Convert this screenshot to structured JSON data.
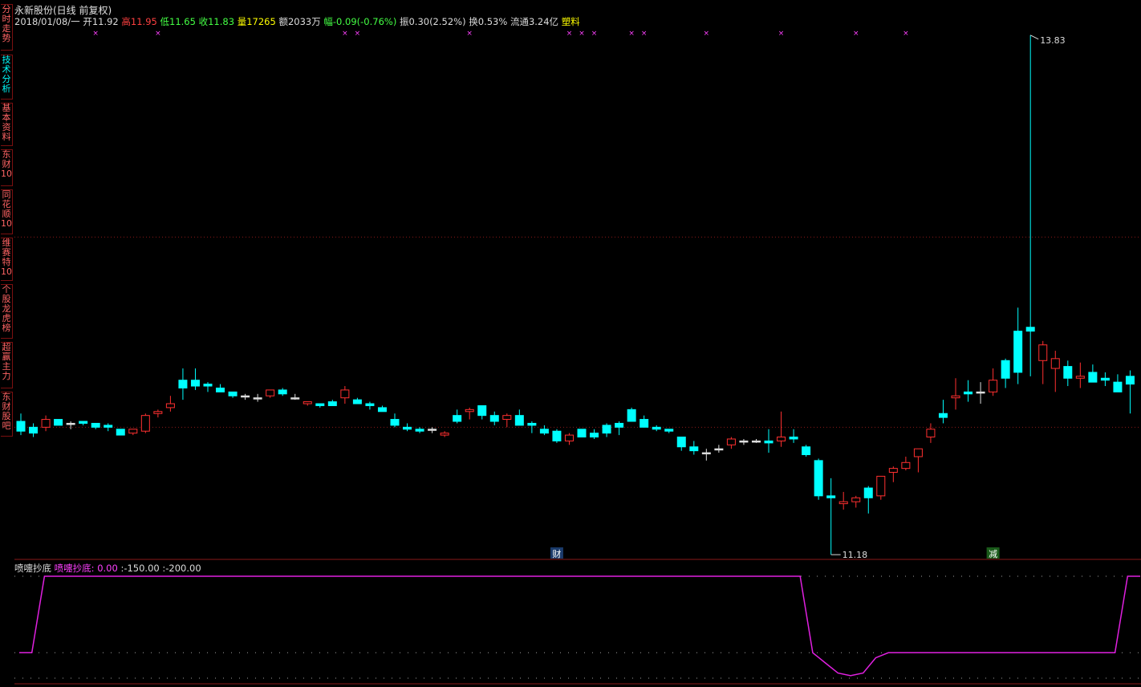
{
  "sidebar": {
    "tabs": [
      {
        "label": "分时走势",
        "active": false
      },
      {
        "label": "技术分析",
        "active": true
      },
      {
        "label": "基本资料",
        "active": false
      },
      {
        "label": "东财10",
        "active": false
      },
      {
        "label": "同花顺10",
        "active": false
      },
      {
        "label": "维赛特10",
        "active": false
      },
      {
        "label": "个股龙虎榜",
        "active": false
      },
      {
        "label": "超赢主力",
        "active": false
      },
      {
        "label": "东财股吧",
        "active": false
      }
    ]
  },
  "header": {
    "title": "永新股份(日线 前复权)",
    "date": "2018/01/08/一",
    "open_label": "开",
    "open": "11.92",
    "high_label": "高",
    "high": "11.95",
    "low_label": "低",
    "low": "11.65",
    "close_label": "收",
    "close": "11.83",
    "volume_label": "量",
    "volume": "17265",
    "amount_label": "额",
    "amount": "2033万",
    "change_label": "幅",
    "change": "-0.09(-0.76%)",
    "amplitude_label": "振",
    "amplitude": "0.30(2.52%)",
    "turnover_label": "换",
    "turnover": "0.53%",
    "float_label": "流通",
    "float_cap": "3.24亿",
    "sector": "塑料"
  },
  "indicator": {
    "name": "喷嚏抄底",
    "series_label": "喷嚏抄底:",
    "value": "0.00",
    "level1": ":-150.00",
    "level2": ":-200.00"
  },
  "chart_data": {
    "type": "candlestick",
    "max_label": "13.83",
    "min_label": "11.18",
    "event_markers": [
      {
        "label": "财",
        "index": 43
      },
      {
        "label": "减",
        "index": 78
      }
    ],
    "colors": {
      "up": "#ff3030",
      "down": "#00ffff",
      "indicator": "#e020e0",
      "grid": "#8a1a1a",
      "dots": "#a0a0a0"
    },
    "candles": [
      [
        11.86,
        11.9,
        11.79,
        11.81
      ],
      [
        11.83,
        11.85,
        11.78,
        11.8
      ],
      [
        11.83,
        11.89,
        11.81,
        11.87
      ],
      [
        11.87,
        11.87,
        11.84,
        11.84
      ],
      [
        11.85,
        11.86,
        11.82,
        11.85
      ],
      [
        11.86,
        11.86,
        11.84,
        11.85
      ],
      [
        11.85,
        11.85,
        11.82,
        11.83
      ],
      [
        11.84,
        11.85,
        11.81,
        11.83
      ],
      [
        11.82,
        11.82,
        11.79,
        11.79
      ],
      [
        11.8,
        11.82,
        11.79,
        11.82
      ],
      [
        11.81,
        11.9,
        11.8,
        11.89
      ],
      [
        11.9,
        11.92,
        11.88,
        11.91
      ],
      [
        11.93,
        11.99,
        11.91,
        11.95
      ],
      [
        12.07,
        12.13,
        11.97,
        12.03
      ],
      [
        12.07,
        12.13,
        12.02,
        12.04
      ],
      [
        12.05,
        12.06,
        12.01,
        12.04
      ],
      [
        12.03,
        12.05,
        12.01,
        12.01
      ],
      [
        12.01,
        12.01,
        11.98,
        11.99
      ],
      [
        11.99,
        12.0,
        11.97,
        11.99
      ],
      [
        11.98,
        12.0,
        11.96,
        11.98
      ],
      [
        11.99,
        12.02,
        11.98,
        12.02
      ],
      [
        12.02,
        12.03,
        11.99,
        12.0
      ],
      [
        11.98,
        12.0,
        11.97,
        11.98
      ],
      [
        11.95,
        11.96,
        11.94,
        11.96
      ],
      [
        11.95,
        11.95,
        11.93,
        11.94
      ],
      [
        11.96,
        11.97,
        11.94,
        11.94
      ],
      [
        11.98,
        12.04,
        11.95,
        12.02
      ],
      [
        11.97,
        11.98,
        11.95,
        11.95
      ],
      [
        11.95,
        11.96,
        11.92,
        11.94
      ],
      [
        11.93,
        11.94,
        11.91,
        11.91
      ],
      [
        11.87,
        11.9,
        11.83,
        11.84
      ],
      [
        11.83,
        11.85,
        11.81,
        11.82
      ],
      [
        11.82,
        11.83,
        11.8,
        11.81
      ],
      [
        11.82,
        11.83,
        11.8,
        11.82
      ],
      [
        11.79,
        11.81,
        11.78,
        11.8
      ],
      [
        11.89,
        11.92,
        11.85,
        11.86
      ],
      [
        11.91,
        11.93,
        11.87,
        11.92
      ],
      [
        11.94,
        11.94,
        11.87,
        11.89
      ],
      [
        11.89,
        11.91,
        11.84,
        11.86
      ],
      [
        11.87,
        11.9,
        11.83,
        11.89
      ],
      [
        11.89,
        11.92,
        11.84,
        11.84
      ],
      [
        11.85,
        11.86,
        11.8,
        11.84
      ],
      [
        11.82,
        11.84,
        11.79,
        11.8
      ],
      [
        11.81,
        11.82,
        11.75,
        11.76
      ],
      [
        11.76,
        11.8,
        11.74,
        11.79
      ],
      [
        11.82,
        11.82,
        11.79,
        11.78
      ],
      [
        11.8,
        11.82,
        11.77,
        11.78
      ],
      [
        11.84,
        11.85,
        11.78,
        11.8
      ],
      [
        11.85,
        11.86,
        11.79,
        11.83
      ],
      [
        11.92,
        11.93,
        11.9,
        11.86
      ],
      [
        11.87,
        11.89,
        11.84,
        11.83
      ],
      [
        11.83,
        11.84,
        11.81,
        11.82
      ],
      [
        11.82,
        11.82,
        11.8,
        11.81
      ],
      [
        11.78,
        11.78,
        11.71,
        11.73
      ],
      [
        11.73,
        11.76,
        11.69,
        11.71
      ],
      [
        11.7,
        11.72,
        11.66,
        11.7
      ],
      [
        11.72,
        11.74,
        11.7,
        11.72
      ],
      [
        11.74,
        11.78,
        11.72,
        11.77
      ],
      [
        11.76,
        11.77,
        11.74,
        11.76
      ],
      [
        11.76,
        11.77,
        11.75,
        11.76
      ],
      [
        11.76,
        11.82,
        11.7,
        11.75
      ],
      [
        11.76,
        11.91,
        11.73,
        11.78
      ],
      [
        11.78,
        11.82,
        11.75,
        11.77
      ],
      [
        11.73,
        11.74,
        11.68,
        11.69
      ],
      [
        11.66,
        11.67,
        11.46,
        11.48
      ],
      [
        11.48,
        11.57,
        11.18,
        11.47
      ],
      [
        11.44,
        11.5,
        11.41,
        11.45
      ],
      [
        11.45,
        11.48,
        11.42,
        11.47
      ],
      [
        11.52,
        11.53,
        11.39,
        11.47
      ],
      [
        11.48,
        11.58,
        11.46,
        11.58
      ],
      [
        11.6,
        11.63,
        11.55,
        11.62
      ],
      [
        11.62,
        11.68,
        11.61,
        11.65
      ],
      [
        11.68,
        11.72,
        11.6,
        11.72
      ],
      [
        11.78,
        11.85,
        11.75,
        11.82
      ],
      [
        11.9,
        11.97,
        11.85,
        11.88
      ],
      [
        11.98,
        12.08,
        11.92,
        11.99
      ],
      [
        12.01,
        12.07,
        11.96,
        12.0
      ],
      [
        12.01,
        12.06,
        11.95,
        12.01
      ],
      [
        12.01,
        12.13,
        11.99,
        12.07
      ],
      [
        12.17,
        12.18,
        12.03,
        12.08
      ],
      [
        12.32,
        12.44,
        12.05,
        12.11
      ],
      [
        12.34,
        13.83,
        12.09,
        12.32
      ],
      [
        12.17,
        12.27,
        12.05,
        12.25
      ],
      [
        12.13,
        12.22,
        12.01,
        12.18
      ],
      [
        12.14,
        12.17,
        12.04,
        12.08
      ],
      [
        12.08,
        12.16,
        12.03,
        12.09
      ],
      [
        12.11,
        12.15,
        12.06,
        12.06
      ],
      [
        12.08,
        12.11,
        12.04,
        12.07
      ],
      [
        12.06,
        12.1,
        12.02,
        12.01
      ],
      [
        12.09,
        12.12,
        11.9,
        12.05
      ]
    ],
    "indicator_values": [
      -150,
      -150,
      0,
      0,
      0,
      0,
      0,
      0,
      0,
      0,
      0,
      0,
      0,
      0,
      0,
      0,
      0,
      0,
      0,
      0,
      0,
      0,
      0,
      0,
      0,
      0,
      0,
      0,
      0,
      0,
      0,
      0,
      0,
      0,
      0,
      0,
      0,
      0,
      0,
      0,
      0,
      0,
      0,
      0,
      0,
      0,
      0,
      0,
      0,
      0,
      0,
      0,
      0,
      0,
      0,
      0,
      0,
      0,
      0,
      0,
      0,
      0,
      0,
      -150,
      -170,
      -190,
      -195,
      -190,
      -160,
      -150,
      -150,
      -150,
      -150,
      -150,
      -150,
      -150,
      -150,
      -150,
      -150,
      -150,
      -150,
      -150,
      -150,
      -150,
      -150,
      -150,
      -150,
      -150,
      0,
      0
    ],
    "ylim": [
      11.16,
      13.87
    ]
  }
}
